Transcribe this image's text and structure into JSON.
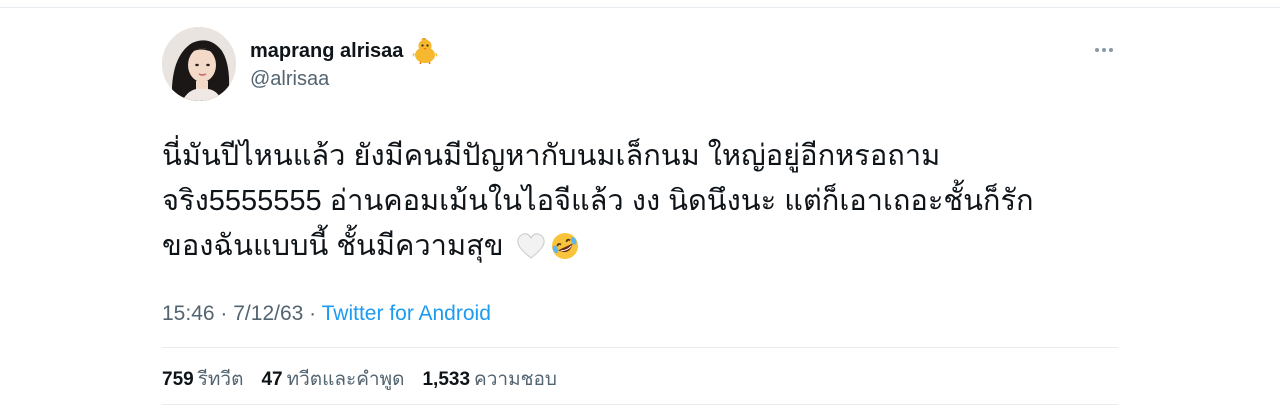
{
  "tweet": {
    "display_name": "maprang alrisaa",
    "handle": "@alrisaa",
    "name_emoji_icon": "baby-chick-icon",
    "text_lines": [
      "นี่มันปีไหนแล้ว ยังมีคนมีปัญหากับนมเล็กนม ใหญ่อยู่อีกหรอถาม",
      "จริง5555555 อ่านคอมเม้นในไอจีแล้ว งง นิดนึงนะ แต่ก็เอาเถอะชั้นก็รัก",
      "ของฉันแบบนี้ ชั้นมีความสุข"
    ],
    "text_emojis": [
      "white-heart-icon",
      "rofl-face-icon"
    ],
    "time": "15:46",
    "date": "7/12/63",
    "dot": "·",
    "source": "Twitter for Android",
    "stats": {
      "retweets_count": "759",
      "retweets_label": "รีทวีต",
      "quotes_count": "47",
      "quotes_label": "ทวีตและคำพูด",
      "likes_count": "1,533",
      "likes_label": "ความชอบ"
    },
    "colors": {
      "link": "#1d9bf0",
      "secondary_text": "#536471",
      "primary_text": "#0f1419"
    }
  }
}
